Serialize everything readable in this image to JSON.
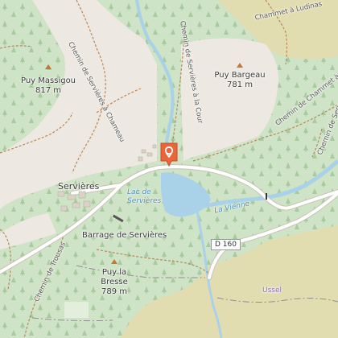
{
  "map": {
    "peaks": [
      {
        "name": "Puy Massigou",
        "elev": "817 m"
      },
      {
        "name": "Puy Bargeau",
        "elev": "781 m"
      },
      {
        "name": "Puy la\nBresse",
        "elev": "789 m"
      }
    ],
    "places": {
      "village": "Servières",
      "dam": "Barrage de Servières",
      "ussel": "Ussel"
    },
    "water": {
      "lake": "Lac de\nServières",
      "river": "La Vienne"
    },
    "paths": {
      "chemin_servieres_chameau": "Chemin de Servières à Chameau",
      "chemin_servieres_la_cour": "Chemin de Servières à la Cour",
      "chemin_chammet_ludinas_top": "Chammet à Ludinas",
      "chemin_chammet_ludinas_right": "Chemin de Chammet à Ludinas",
      "chemin_de_servieres_right": "Chemin de Serv",
      "chemin_trousas": "Chemin de Trousas"
    },
    "road_ref": "D 160",
    "marker": {
      "icon": "location-pin-icon",
      "color": "#e8663a"
    },
    "colors": {
      "forest": "#cfe3c6",
      "open": "#ede9e2",
      "farmland": "#e2ddb0",
      "water": "#a9d1e8",
      "road": "#ffffff",
      "path": "#b8875a"
    }
  }
}
